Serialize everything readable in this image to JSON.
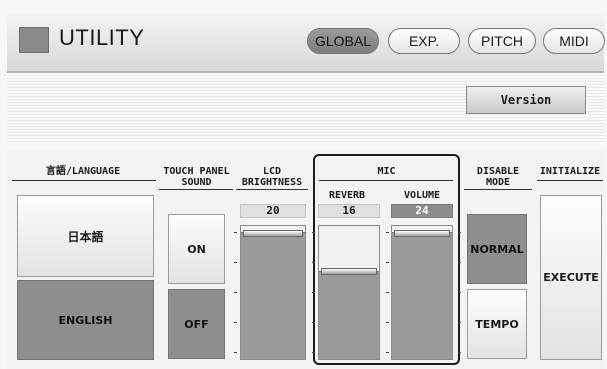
{
  "header": {
    "title": "UTILITY",
    "tabs": [
      {
        "label": "GLOBAL",
        "active": true
      },
      {
        "label": "EXP.",
        "active": false
      },
      {
        "label": "PITCH",
        "active": false
      },
      {
        "label": "MIDI",
        "active": false
      }
    ]
  },
  "version_button": "Version",
  "language": {
    "label": "言語/LANGUAGE",
    "options": [
      "日本語",
      "ENGLISH"
    ],
    "selected": "ENGLISH"
  },
  "touch_panel_sound": {
    "label_line1": "TOUCH PANEL",
    "label_line2": "SOUND",
    "options": [
      "ON",
      "OFF"
    ],
    "selected": "OFF"
  },
  "lcd_brightness": {
    "label_line1": "LCD",
    "label_line2": "BRIGHTNESS",
    "value": "20"
  },
  "mic": {
    "label": "MIC",
    "reverb": {
      "label": "REVERB",
      "value": "16"
    },
    "volume": {
      "label": "VOLUME",
      "value": "24",
      "active": true
    }
  },
  "disable_mode": {
    "label_line1": "DISABLE",
    "label_line2": "MODE",
    "options": [
      "NORMAL",
      "TEMPO"
    ],
    "selected": "NORMAL"
  },
  "initialize": {
    "label": "INITIALIZE",
    "button": "EXECUTE"
  }
}
